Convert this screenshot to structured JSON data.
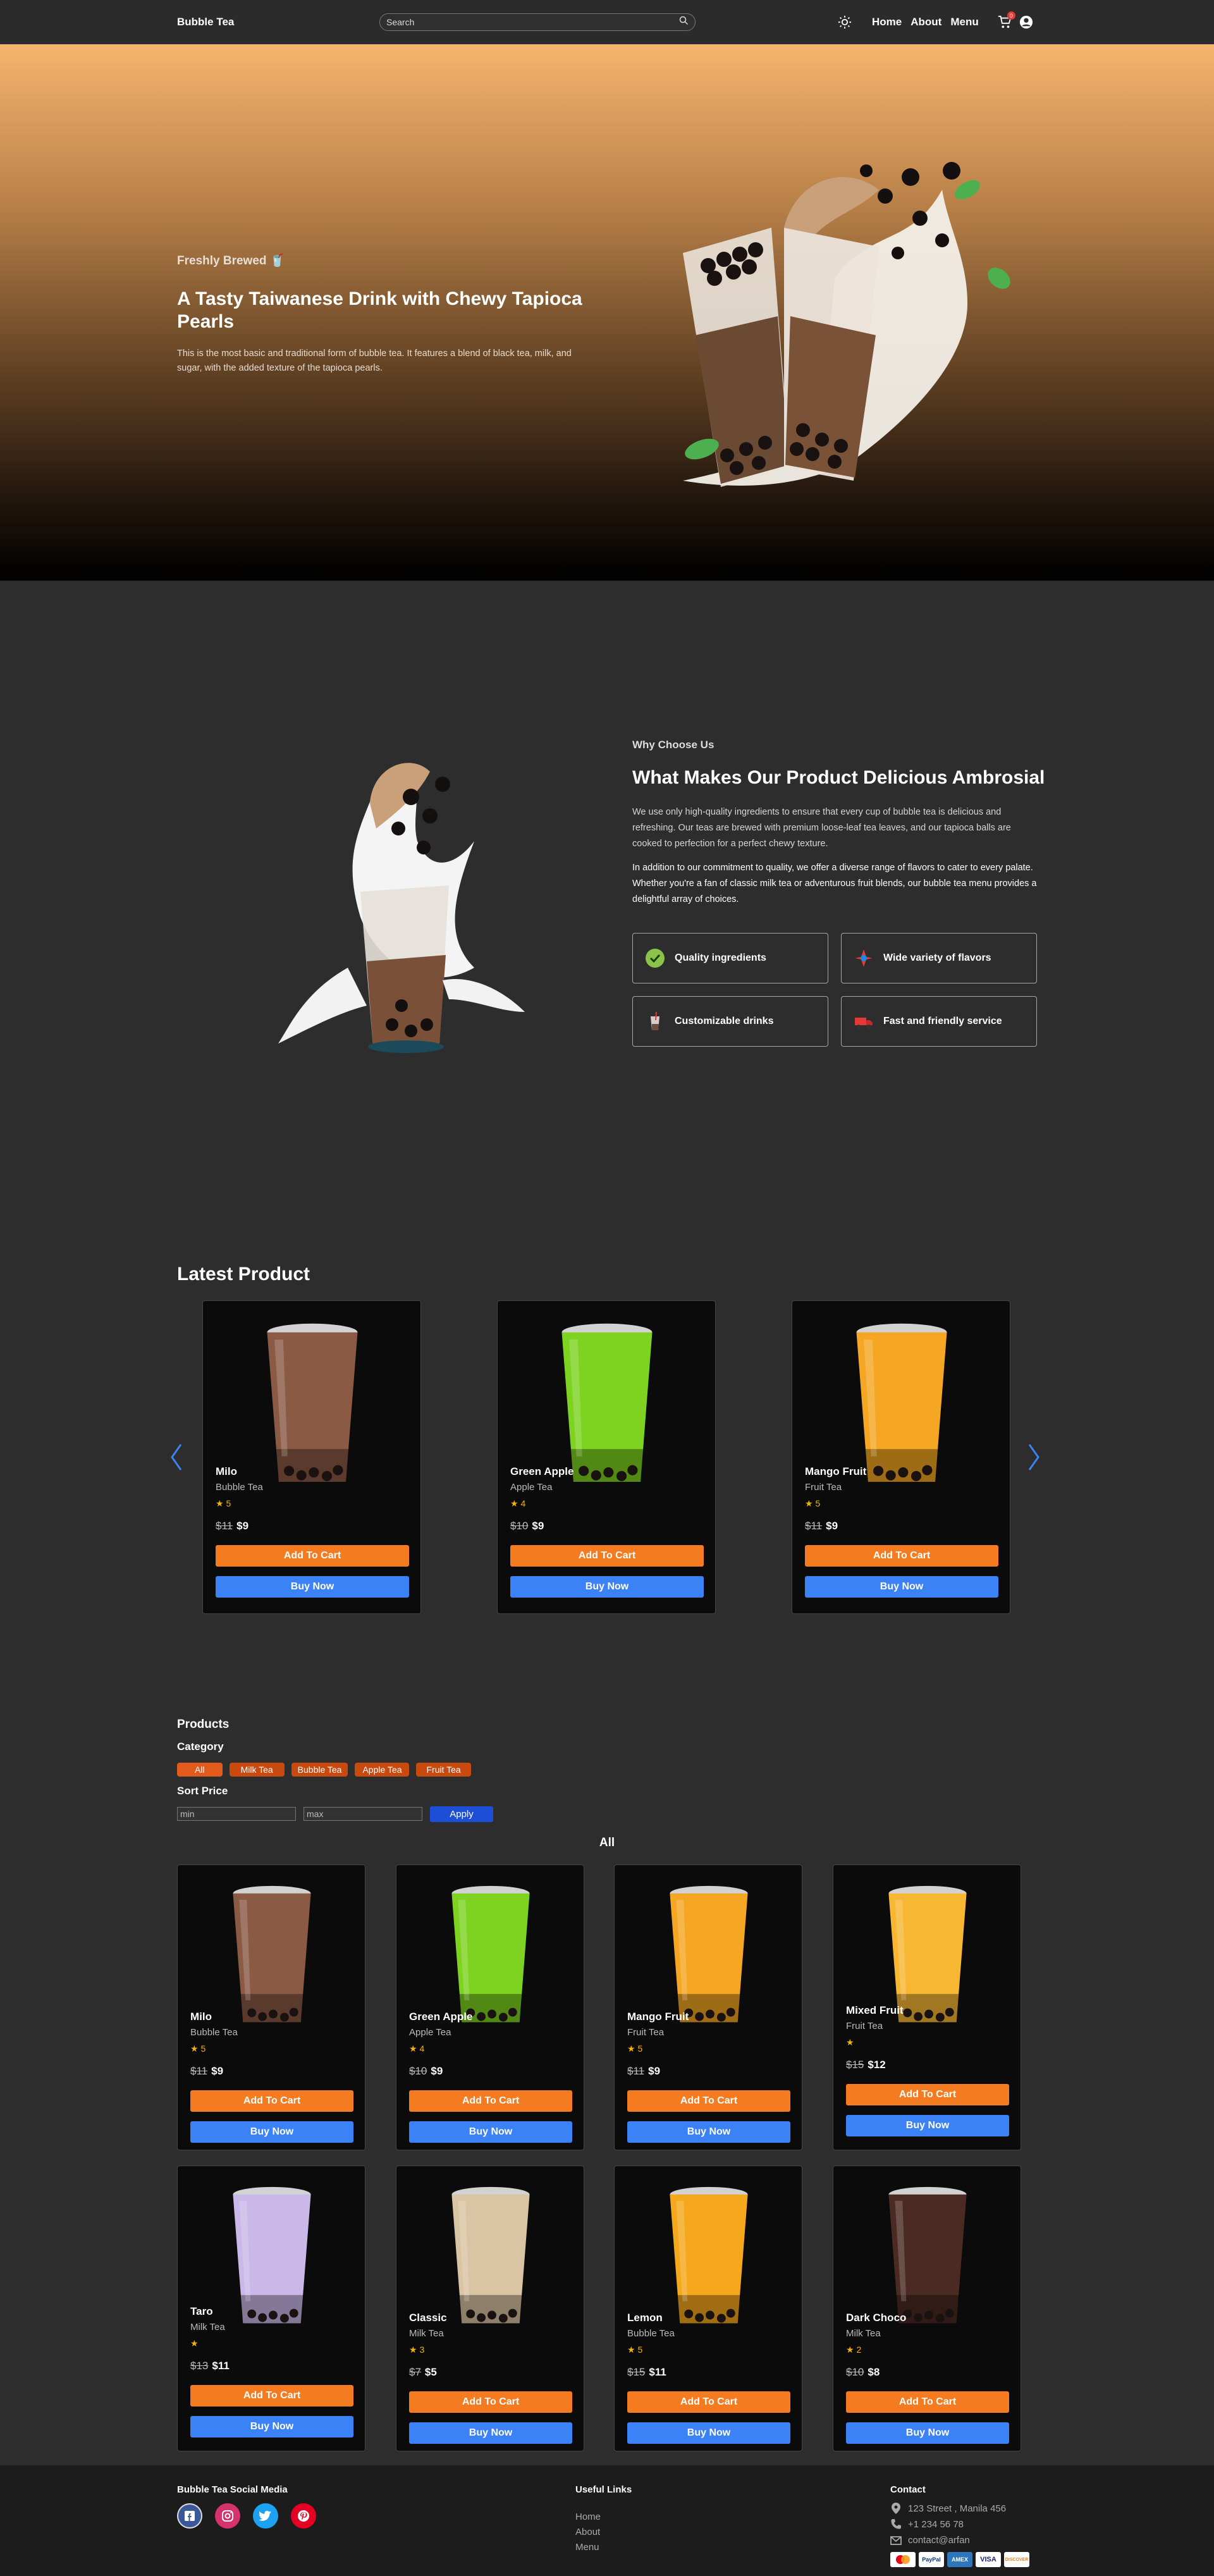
{
  "nav": {
    "brand": "Bubble Tea",
    "search_placeholder": "Search",
    "links": [
      "Home",
      "About",
      "Menu"
    ],
    "cart_count": "0"
  },
  "hero": {
    "subtitle": "Freshly Brewed",
    "title": "A Tasty Taiwanese Drink with Chewy Tapioca Pearls",
    "text": "This is the most basic and traditional form of bubble tea. It features a blend of black tea, milk, and sugar, with the added texture of the tapioca pearls."
  },
  "why": {
    "subtitle": "Why Choose Us",
    "title": "What Makes Our Product Delicious Ambrosial",
    "p1": "We use only high-quality ingredients to ensure that every cup of bubble tea is delicious and refreshing. Our teas are brewed with premium loose-leaf tea leaves, and our tapioca balls are cooked to perfection for a perfect chewy texture.",
    "p2": "In addition to our commitment to quality, we offer a diverse range of flavors to cater to every palate. Whether you're a fan of classic milk tea or adventurous fruit blends, our bubble tea menu provides a delightful array of choices.",
    "features": [
      "Quality ingredients",
      "Wide variety of flavors",
      "Customizable drinks",
      "Fast and friendly service"
    ]
  },
  "latest": {
    "title": "Latest Product",
    "items": [
      {
        "name": "Milo",
        "category": "Bubble Tea",
        "rating": "★ 5",
        "old_price": "$11",
        "price": "$9",
        "color": "#8a5a45"
      },
      {
        "name": "Green Apple",
        "category": "Apple Tea",
        "rating": "★ 4",
        "old_price": "$10",
        "price": "$9",
        "color": "#7ed321"
      },
      {
        "name": "Mango Fruit",
        "category": "Fruit Tea",
        "rating": "★ 5",
        "old_price": "$11",
        "price": "$9",
        "color": "#f5a623"
      }
    ]
  },
  "buttons": {
    "add_to_cart": "Add To Cart",
    "buy_now": "Buy Now"
  },
  "products": {
    "title": "Products",
    "category_label": "Category",
    "categories": [
      "All",
      "Milk Tea",
      "Bubble Tea",
      "Apple Tea",
      "Fruit Tea"
    ],
    "sort_label": "Sort Price",
    "min_placeholder": "min",
    "max_placeholder": "max",
    "apply": "Apply",
    "grid_title": "All",
    "items": [
      {
        "name": "Milo",
        "category": "Bubble Tea",
        "rating": "★ 5",
        "old_price": "$11",
        "price": "$9",
        "color": "#8a5a45"
      },
      {
        "name": "Green Apple",
        "category": "Apple Tea",
        "rating": "★ 4",
        "old_price": "$10",
        "price": "$9",
        "color": "#7ed321"
      },
      {
        "name": "Mango Fruit",
        "category": "Fruit Tea",
        "rating": "★ 5",
        "old_price": "$11",
        "price": "$9",
        "color": "#f5a623"
      },
      {
        "name": "Mixed Fruit",
        "category": "Fruit Tea",
        "rating": "★",
        "old_price": "$15",
        "price": "$12",
        "color": "#f7b733"
      },
      {
        "name": "Taro",
        "category": "Milk Tea",
        "rating": "★",
        "old_price": "$13",
        "price": "$11",
        "color": "#c9b8e8"
      },
      {
        "name": "Classic",
        "category": "Milk Tea",
        "rating": "★ 3",
        "old_price": "$7",
        "price": "$5",
        "color": "#d9c4a3"
      },
      {
        "name": "Lemon",
        "category": "Bubble Tea",
        "rating": "★ 5",
        "old_price": "$15",
        "price": "$11",
        "color": "#f6a81d"
      },
      {
        "name": "Dark Choco",
        "category": "Milk Tea",
        "rating": "★ 2",
        "old_price": "$10",
        "price": "$8",
        "color": "#4a2a22"
      }
    ]
  },
  "footer": {
    "social_title": "Bubble Tea Social Media",
    "links_title": "Useful Links",
    "links": [
      "Home",
      "About",
      "Menu"
    ],
    "contact_title": "Contact",
    "address": "123 Street , Manila 456",
    "phone": "+1 234 56 78",
    "email": "contact@arfan",
    "social_icons": [
      "facebook-icon",
      "instagram-icon",
      "twitter-icon",
      "pinterest-icon"
    ],
    "payments": [
      "MasterCard",
      "PayPal",
      "AMEX",
      "VISA",
      "DISCOVER"
    ]
  }
}
